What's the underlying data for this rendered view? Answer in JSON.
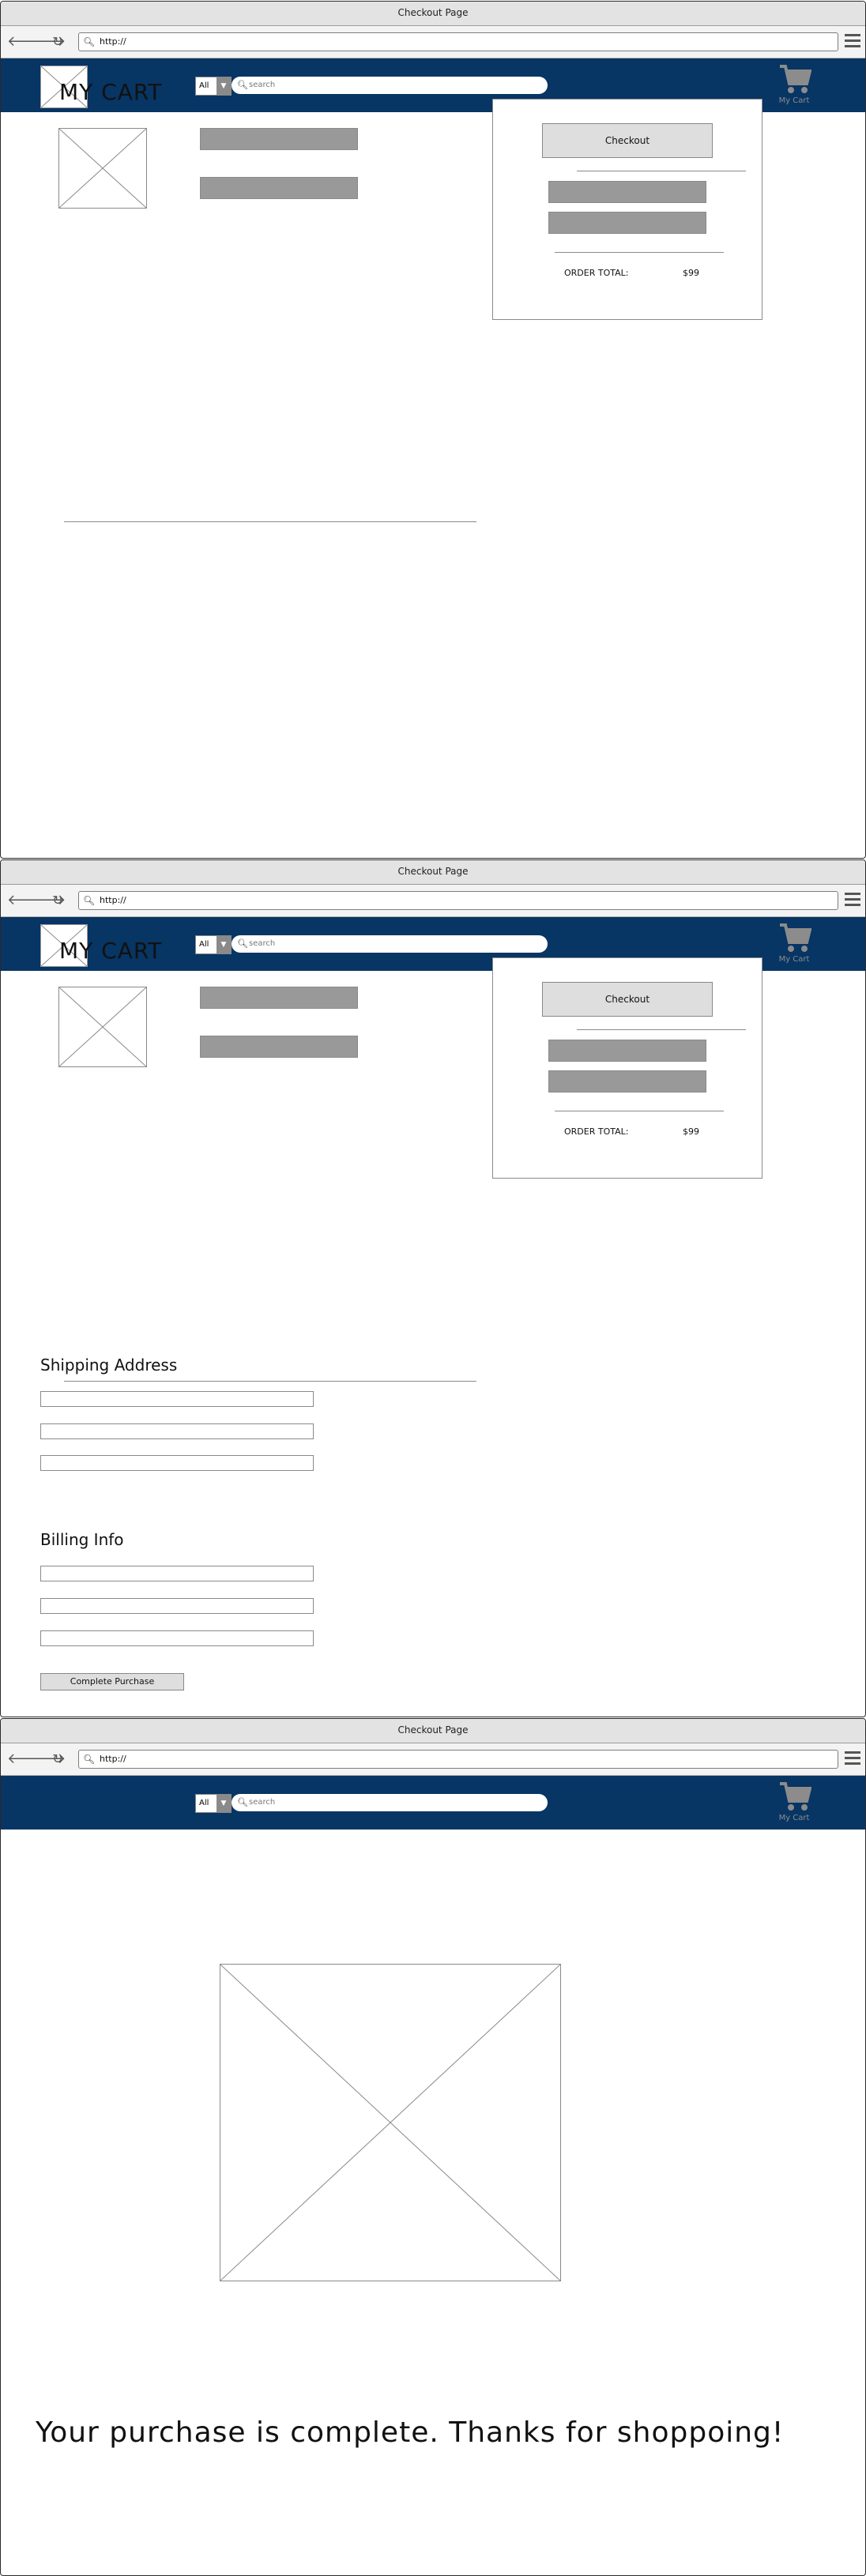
{
  "browser": {
    "title": "Checkout Page",
    "url": "http://",
    "back_icon": "back-arrow-icon",
    "forward_icon": "forward-arrow-icon",
    "reload_icon": "reload-icon",
    "menu_icon": "hamburger-menu-icon"
  },
  "header": {
    "category_select": "All",
    "search_placeholder": "search",
    "cart_label": "My Cart",
    "bar_color": "#073564"
  },
  "cart_page": {
    "title": "MY CART",
    "checkout_label": "Checkout",
    "order_total_label": "ORDER TOTAL:",
    "order_total_value": "$99"
  },
  "shipping": {
    "heading": "Shipping Address"
  },
  "billing": {
    "heading": "Billing Info",
    "complete_label": "Complete Purchase"
  },
  "confirmation": {
    "message": "Your purchase is complete.  Thanks for shoppoing!"
  }
}
